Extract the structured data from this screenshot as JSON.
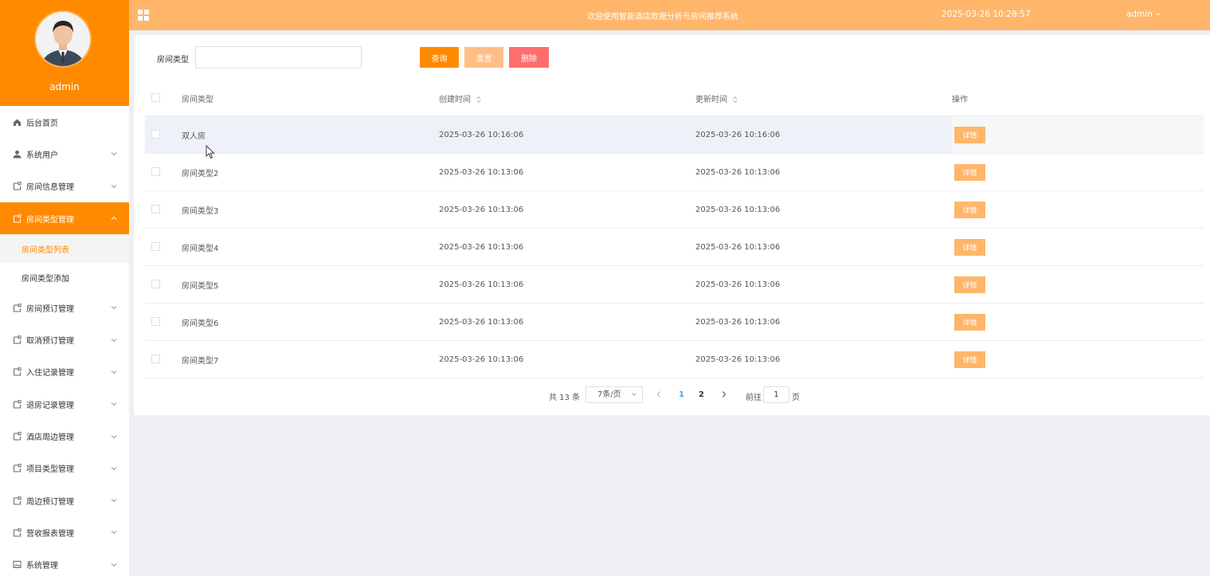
{
  "sidebar": {
    "username": "admin",
    "menu": [
      {
        "label": "后台首页",
        "icon": "home-icon"
      },
      {
        "label": "系统用户",
        "icon": "user-icon"
      },
      {
        "label": "房间信息管理",
        "icon": "doc-icon"
      },
      {
        "label": "房间类型管理",
        "icon": "doc-icon"
      },
      {
        "label": "房间预订管理",
        "icon": "doc-icon"
      },
      {
        "label": "取消预订管理",
        "icon": "doc-icon"
      },
      {
        "label": "入住记录管理",
        "icon": "doc-icon"
      },
      {
        "label": "退房记录管理",
        "icon": "doc-icon"
      },
      {
        "label": "酒店周边管理",
        "icon": "doc-icon"
      },
      {
        "label": "项目类型管理",
        "icon": "doc-icon"
      },
      {
        "label": "周边预订管理",
        "icon": "doc-icon"
      },
      {
        "label": "营收报表管理",
        "icon": "doc-icon"
      },
      {
        "label": "系统管理",
        "icon": "image-icon"
      }
    ],
    "submenu": [
      {
        "label": "房间类型列表"
      },
      {
        "label": "房间类型添加"
      }
    ]
  },
  "header": {
    "title": "欢迎使用智能酒店数据分析与房间推荐系统",
    "time": "2025-03-26 10:28:57",
    "user": "admin"
  },
  "search": {
    "label": "房间类型",
    "value": "",
    "query": "查询",
    "reset": "重置",
    "delete": "删除"
  },
  "table": {
    "columns": [
      "房间类型",
      "创建时间",
      "更新时间",
      "操作"
    ],
    "detail_label": "详情",
    "rows": [
      {
        "type": "双人房",
        "created": "2025-03-26 10:16:06",
        "updated": "2025-03-26 10:16:06"
      },
      {
        "type": "房间类型2",
        "created": "2025-03-26 10:13:06",
        "updated": "2025-03-26 10:13:06"
      },
      {
        "type": "房间类型3",
        "created": "2025-03-26 10:13:06",
        "updated": "2025-03-26 10:13:06"
      },
      {
        "type": "房间类型4",
        "created": "2025-03-26 10:13:06",
        "updated": "2025-03-26 10:13:06"
      },
      {
        "type": "房间类型5",
        "created": "2025-03-26 10:13:06",
        "updated": "2025-03-26 10:13:06"
      },
      {
        "type": "房间类型6",
        "created": "2025-03-26 10:13:06",
        "updated": "2025-03-26 10:13:06"
      },
      {
        "type": "房间类型7",
        "created": "2025-03-26 10:13:06",
        "updated": "2025-03-26 10:13:06"
      }
    ]
  },
  "pagination": {
    "total": "共 13 条",
    "page_size": "7条/页",
    "page1": "1",
    "page2": "2",
    "goto": "前往",
    "current": "1",
    "page_unit": "页"
  },
  "colors": {
    "primary": "#ff8a00",
    "header": "#ffb66b",
    "danger": "#ff6e6e"
  }
}
